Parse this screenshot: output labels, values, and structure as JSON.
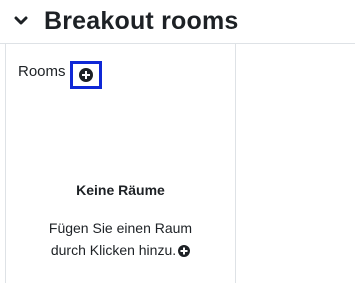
{
  "header": {
    "title": "Breakout rooms",
    "toggle_icon": "chevron-down-icon"
  },
  "rooms_panel": {
    "label": "Rooms",
    "add_icon": "plus-circle-icon",
    "empty_state": {
      "title": "Keine Räume",
      "description_line1": "Fügen Sie einen Raum",
      "description_line2": "durch Klicken hinzu.",
      "icon": "plus-circle-icon"
    }
  },
  "colors": {
    "text": "#1d2125",
    "focus_outline": "#0f28d6",
    "border": "#dee2e6"
  }
}
